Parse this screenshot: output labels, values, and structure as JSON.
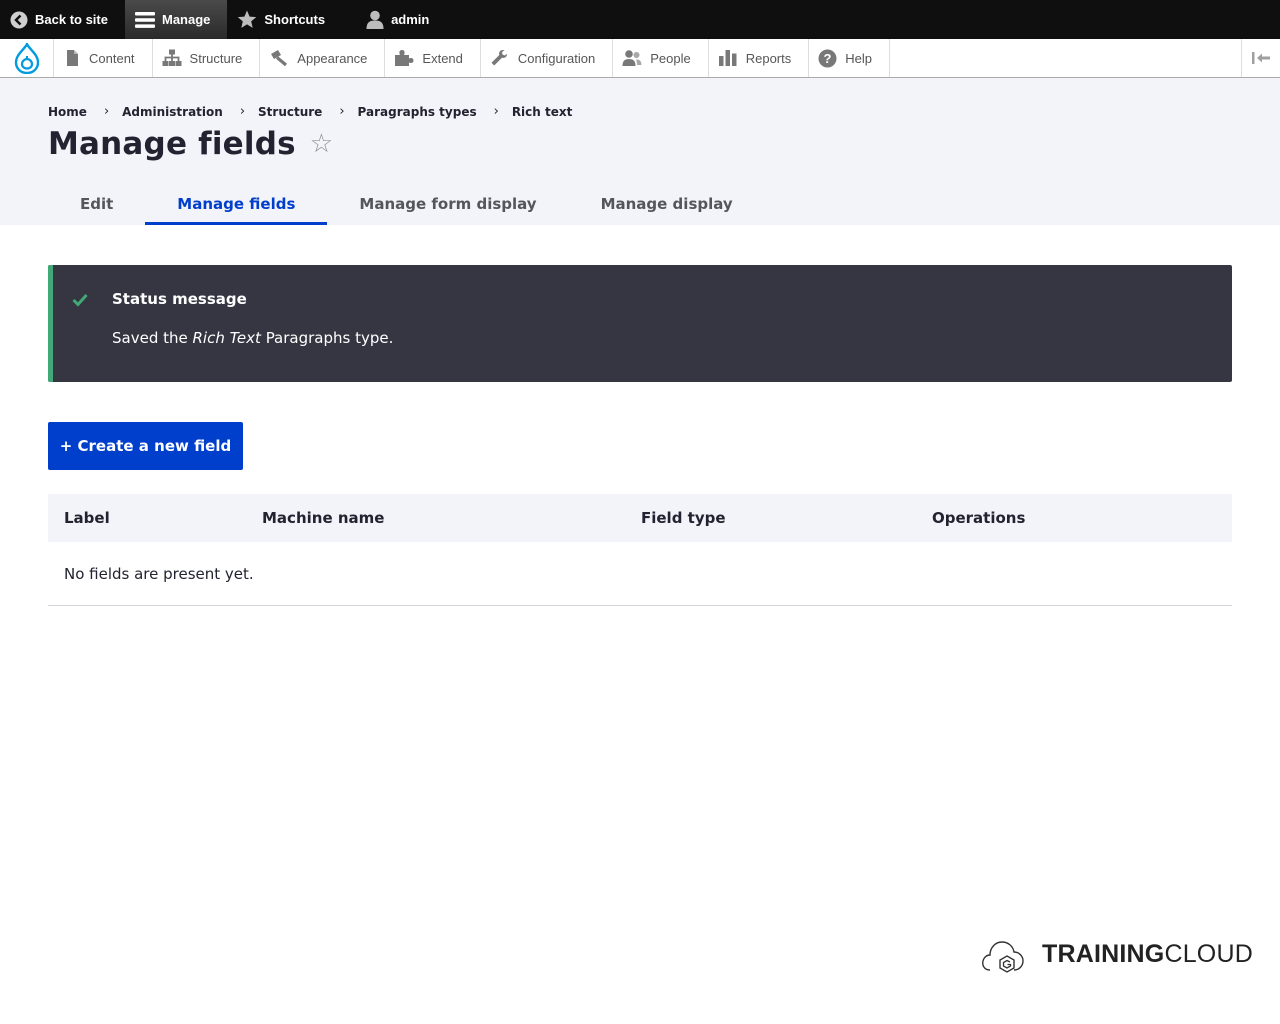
{
  "toolbar": {
    "back_to_site": "Back to site",
    "manage": "Manage",
    "shortcuts": "Shortcuts",
    "user": "admin"
  },
  "tray": {
    "items": [
      {
        "label": "Content",
        "icon": "file-icon"
      },
      {
        "label": "Structure",
        "icon": "sitemap-icon"
      },
      {
        "label": "Appearance",
        "icon": "paintbrush-icon"
      },
      {
        "label": "Extend",
        "icon": "puzzle-icon"
      },
      {
        "label": "Configuration",
        "icon": "wrench-icon"
      },
      {
        "label": "People",
        "icon": "people-icon"
      },
      {
        "label": "Reports",
        "icon": "bar-chart-icon"
      },
      {
        "label": "Help",
        "icon": "help-icon"
      }
    ],
    "accent": "#009cde"
  },
  "breadcrumb": [
    "Home",
    "Administration",
    "Structure",
    "Paragraphs types",
    "Rich text"
  ],
  "page": {
    "title": "Manage fields",
    "star": "☆"
  },
  "tabs": [
    {
      "label": "Edit",
      "active": false
    },
    {
      "label": "Manage fields",
      "active": true
    },
    {
      "label": "Manage form display",
      "active": false
    },
    {
      "label": "Manage display",
      "active": false
    }
  ],
  "status": {
    "title": "Status message",
    "prefix": "Saved the ",
    "emphasis": "Rich Text",
    "suffix": " Paragraphs type.",
    "accent": "#42a877"
  },
  "create_button": "+ Create a new field",
  "table": {
    "headers": [
      "Label",
      "Machine name",
      "Field type",
      "Operations"
    ],
    "empty": "No fields are present yet."
  },
  "brand": {
    "part1": "TRAINING",
    "part2": "CLOUD"
  },
  "colors": {
    "primary": "#003ecc",
    "status_bg": "#353641",
    "header_bg": "#f3f4f9"
  }
}
